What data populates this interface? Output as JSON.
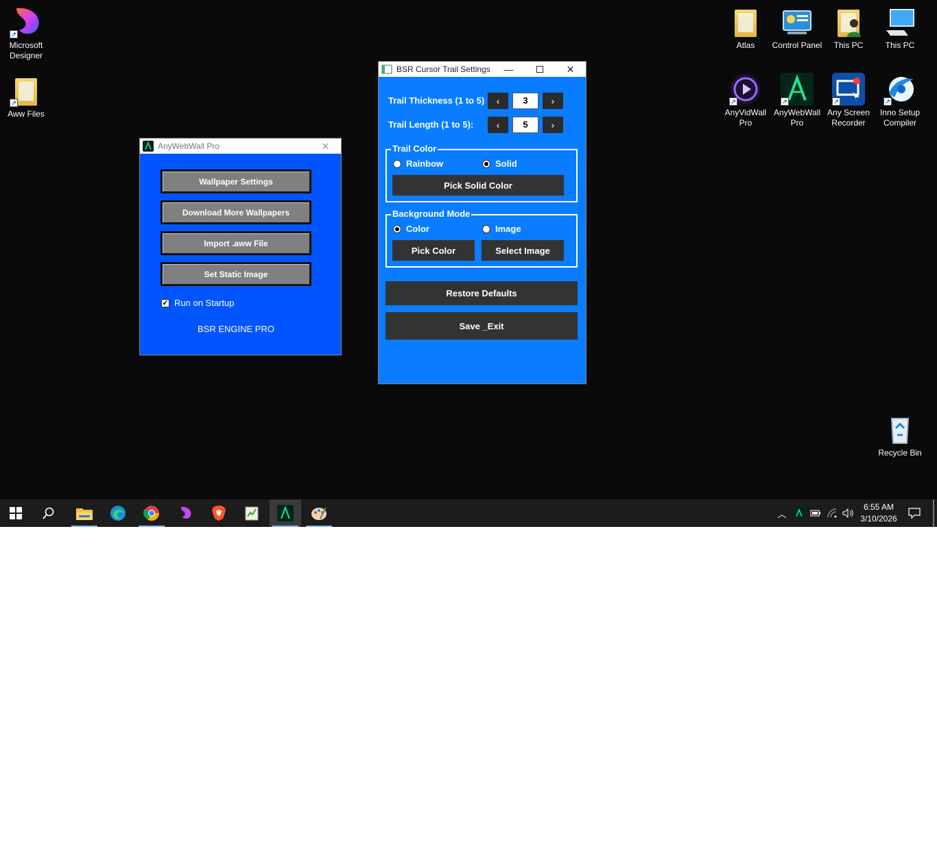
{
  "desktop": {
    "icons": [
      {
        "label": "Microsoft Designer"
      },
      {
        "label": "Aww Files"
      },
      {
        "label": "Atlas"
      },
      {
        "label": "Control Panel"
      },
      {
        "label": "This PC"
      },
      {
        "label": "This PC"
      },
      {
        "label": "AnyVidWall Pro"
      },
      {
        "label": "AnyWebWall Pro"
      },
      {
        "label": "Any Screen Recorder"
      },
      {
        "label": "Inno Setup Compiler"
      },
      {
        "label": "Recycle Bin"
      }
    ]
  },
  "aww_window": {
    "title": "AnyWebWall Pro",
    "buttons": [
      "Wallpaper Settings",
      "Download More Wallpapers",
      "Import .aww File",
      "Set Static Image"
    ],
    "startup_label": "Run on Startup",
    "startup_checked": true,
    "footer": "BSR ENGINE PRO"
  },
  "trail_window": {
    "title": "BSR Cursor Trail Settings",
    "thickness_label": "Trail Thickness (1 to 5):",
    "thickness_value": "3",
    "length_label": "Trail Length (1 to 5):",
    "length_value": "5",
    "trail_color": {
      "legend": "Trail Color",
      "option_rainbow": "Rainbow",
      "option_solid": "Solid",
      "selected": "Solid",
      "pick_button": "Pick Solid Color"
    },
    "background_mode": {
      "legend": "Background Mode",
      "option_color": "Color",
      "option_image": "Image",
      "selected": "Color",
      "pick_color_button": "Pick Color",
      "select_image_button": "Select Image"
    },
    "restore_button": "Restore Defaults",
    "save_button": "Save _Exit"
  },
  "taskbar": {
    "time": "6:55 AM",
    "date": "3/10/2026"
  },
  "colors": {
    "aww_bg": "#0055ff",
    "trail_bg": "#0a7cff",
    "button_dark": "#333333",
    "taskbar": "#1c1c1c"
  }
}
